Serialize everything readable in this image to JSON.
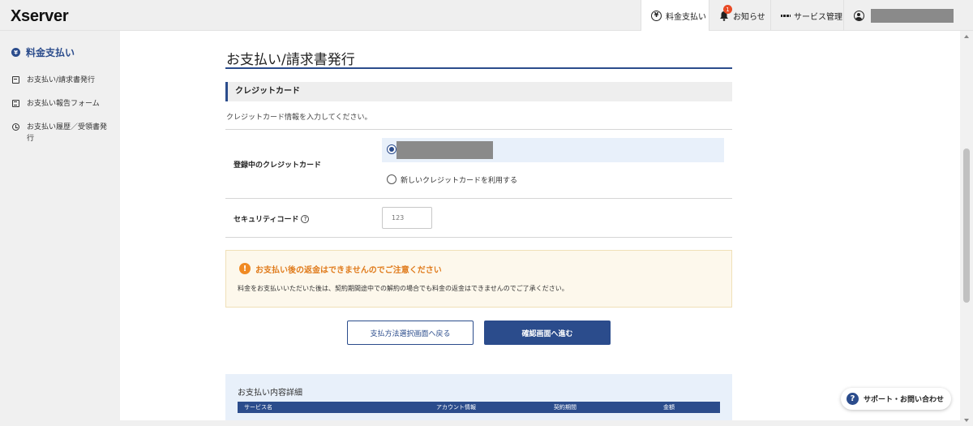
{
  "header": {
    "logo": "Xserver",
    "nav": [
      {
        "label": "料金支払い",
        "icon": "yen-icon",
        "active": true
      },
      {
        "label": "お知らせ",
        "icon": "bell-icon",
        "badge": "1"
      },
      {
        "label": "サービス管理",
        "icon": "grid-icon"
      },
      {
        "label": "",
        "icon": "user-icon"
      }
    ]
  },
  "sidebar": {
    "title": "料金支払い",
    "items": [
      {
        "label": "お支払い/請求書発行",
        "icon": "invoice-icon"
      },
      {
        "label": "お支払い報告フォーム",
        "icon": "form-icon"
      },
      {
        "label": "お支払い履歴／受領書発行",
        "icon": "clock-icon"
      }
    ]
  },
  "main": {
    "title": "お支払い/請求書発行",
    "section_title": "クレジットカード",
    "section_desc": "クレジットカード情報を入力してください。",
    "registered_card_label": "登録中のクレジットカード",
    "new_card_label": "新しいクレジットカードを利用する",
    "security_code_label": "セキュリティコード",
    "security_code_placeholder": "123",
    "notice_title": "お支払い後の返金はできませんのでご注意ください",
    "notice_text": "料金をお支払いいただいた後は、契約期間途中での解約の場合でも料金の返金はできませんのでご了承ください。",
    "back_button": "支払方法選択画面へ戻る",
    "next_button": "確認画面へ進む",
    "detail_title": "お支払い内容詳細",
    "detail_columns": [
      "サービス名",
      "アカウント情報",
      "契約期間",
      "金額"
    ]
  },
  "support_button": "サポート・お問い合わせ",
  "colors": {
    "brand": "#2b4c8c",
    "warning": "#e07b1c"
  }
}
